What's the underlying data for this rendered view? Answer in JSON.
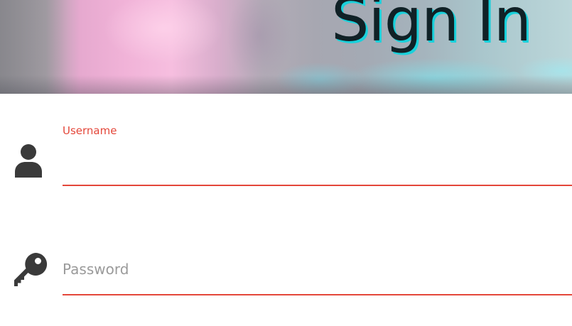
{
  "header": {
    "title": "Sign In"
  },
  "form": {
    "username": {
      "label": "Username",
      "value": "",
      "icon": "user-icon"
    },
    "password": {
      "placeholder": "Password",
      "value": "",
      "icon": "key-icon"
    }
  },
  "colors": {
    "accent": "#e4473a",
    "title_text": "#102126",
    "title_shadow": "#19d1db",
    "icon": "#3a3a3a"
  }
}
